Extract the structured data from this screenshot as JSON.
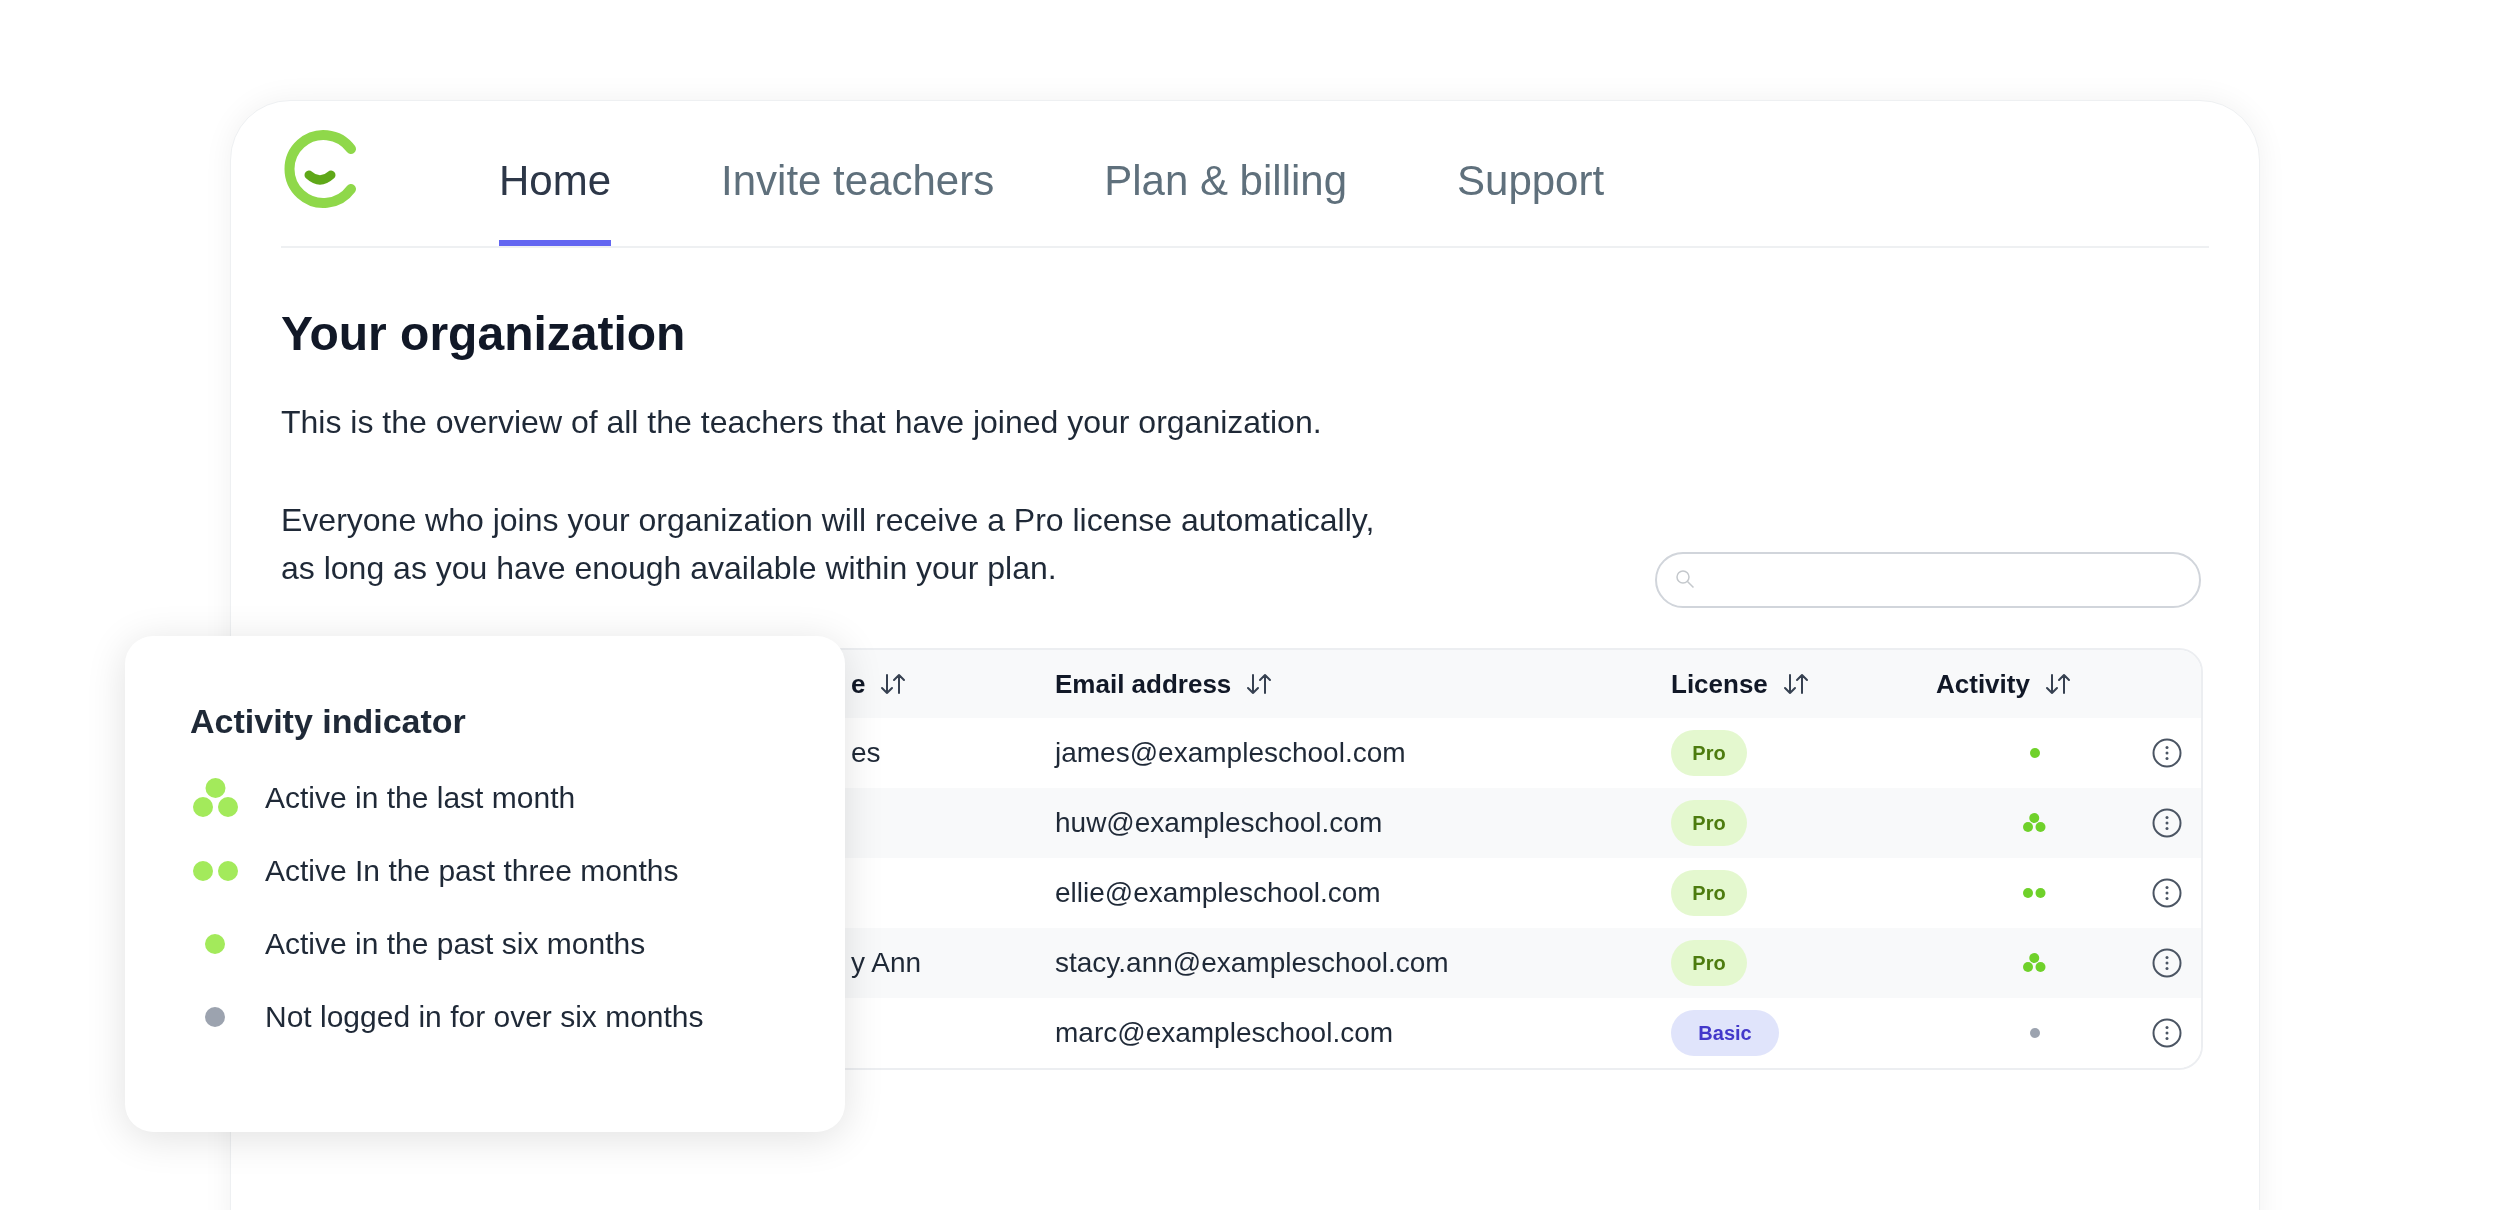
{
  "nav": {
    "tabs": [
      {
        "label": "Home",
        "selected": true
      },
      {
        "label": "Invite teachers",
        "selected": false
      },
      {
        "label": "Plan & billing",
        "selected": false
      },
      {
        "label": "Support",
        "selected": false
      }
    ]
  },
  "page": {
    "title": "Your organization",
    "intro": "This is the overview of all the teachers that have joined your organization.",
    "note_lines": [
      "Everyone who joins your organization will receive a Pro license automatically,",
      "as long as you have enough available within your plan."
    ]
  },
  "table": {
    "columns": [
      "e",
      "Email address",
      "License",
      "Activity"
    ],
    "rows": [
      {
        "name": "es",
        "email": "james@exampleschool.com",
        "license": {
          "label": "Pro",
          "kind": "pro"
        },
        "activity": {
          "kind": "one"
        }
      },
      {
        "email": "huw@exampleschool.com",
        "license": {
          "label": "Pro",
          "kind": "pro"
        },
        "activity": {
          "kind": "three"
        }
      },
      {
        "email": "ellie@exampleschool.com",
        "license": {
          "label": "Pro",
          "kind": "pro"
        },
        "activity": {
          "kind": "two"
        }
      },
      {
        "name": "y Ann",
        "email": "stacy.ann@exampleschool.com",
        "license": {
          "label": "Pro",
          "kind": "pro"
        },
        "activity": {
          "kind": "three"
        }
      },
      {
        "email": "marc@exampleschool.com",
        "license": {
          "label": "Basic",
          "kind": "basic"
        },
        "activity": {
          "kind": "none"
        }
      }
    ]
  },
  "legend": {
    "title": "Activity indicator",
    "items": [
      {
        "kind": "three",
        "label": "Active in the last month"
      },
      {
        "kind": "two",
        "label": "Active In the past three months"
      },
      {
        "kind": "one",
        "label": "Active in the past six months"
      },
      {
        "kind": "none",
        "label": "Not logged in for over six months"
      }
    ]
  }
}
